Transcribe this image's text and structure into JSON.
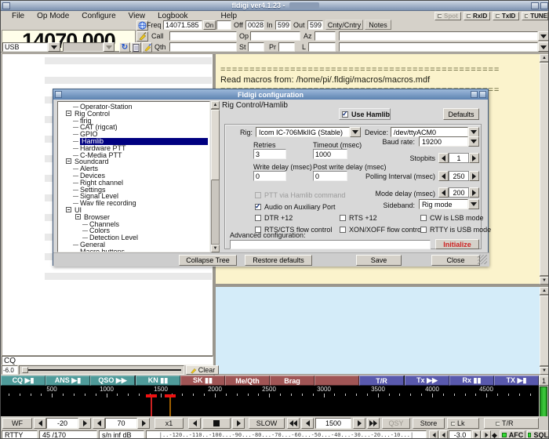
{
  "window": {
    "title": "fldigi ver4.1.23 -"
  },
  "menu": {
    "items": [
      "File",
      "Op Mode",
      "Configure",
      "View",
      "Logbook",
      "Help"
    ]
  },
  "id_buttons": [
    {
      "label": "Spot",
      "disabled": true
    },
    {
      "label": "RxID",
      "disabled": false
    },
    {
      "label": "TxID",
      "disabled": false
    },
    {
      "label": "TUNE",
      "disabled": false
    }
  ],
  "vfo": {
    "frequency": "14070.000",
    "mode": "USB"
  },
  "log_fields": {
    "freq_label": "Freq",
    "freq_value": "14071.585",
    "on_label": "On",
    "time_on_value": "",
    "off_label": "Off",
    "off_value": "0028",
    "in_label": "In",
    "in_value": "599",
    "out_label": "Out",
    "out_value": "599",
    "cnty_label": "Cnty/Cntry",
    "notes_label": "Notes",
    "call_label": "Call",
    "call_value": "",
    "op_label": "Op",
    "op_value": "",
    "az_label": "Az",
    "az_value": "",
    "qth_label": "Qth",
    "qth_value": "",
    "st_label": "St",
    "st_value": "",
    "pr_label": "Pr",
    "pr_value": "",
    "l_label": "L",
    "l_value": ""
  },
  "rx_pane": {
    "lines": [
      "================================================",
      "Read macros from: /home/pi/.fldigi/macros/macros.mdf",
      "================================================"
    ]
  },
  "browser": {
    "decoded_text": "CQ",
    "squelch_value": "-6.0",
    "clear_label": "Clear"
  },
  "macros": {
    "set_label": "1",
    "buttons": [
      {
        "label": "CQ ▶▮",
        "group": "teal"
      },
      {
        "label": "ANS ▶▮",
        "group": "teal"
      },
      {
        "label": "QSO ▶▶",
        "group": "teal"
      },
      {
        "label": "KN ▮▮",
        "group": "teal"
      },
      {
        "label": "SK ▮▮",
        "group": "red"
      },
      {
        "label": "Me/Qth",
        "group": "red"
      },
      {
        "label": "Brag",
        "group": "red"
      },
      {
        "label": "",
        "group": "red"
      },
      {
        "label": "T/R",
        "group": "blue"
      },
      {
        "label": "Tx ▶▶",
        "group": "blue"
      },
      {
        "label": "Rx ▮▮",
        "group": "blue"
      },
      {
        "label": "TX ▶▮",
        "group": "blue"
      }
    ]
  },
  "waterfall": {
    "scale_labels": [
      500,
      1000,
      1500,
      2000,
      2500,
      3000,
      3500,
      4000,
      4500
    ],
    "markers": [
      {
        "freq": 1415,
        "color": "#cc2222"
      },
      {
        "freq": 1585,
        "color": "#a06000"
      }
    ]
  },
  "wf_controls": {
    "wf_label": "WF",
    "lower_signal": "-20",
    "upper_signal": "70",
    "zoom_label": "x1",
    "speed_label": "SLOW",
    "center_freq": "1500",
    "qsy_label": "QSY",
    "store_label": "Store",
    "lock_label": "Lk",
    "tr_label": "T/R"
  },
  "status": {
    "mode": "RTTY",
    "shift": "45 /170",
    "snr": "s/n inf dB",
    "meter_scale": "|..-120..-110..-100...-90...-80...-70...-60...-50...-40...-30...-20...-10...|",
    "squelch_value": "-3.0",
    "afc_label": "AFC",
    "sql_label": "SQL"
  },
  "dialog": {
    "title": "Fldigi configuration",
    "tree": [
      {
        "label": "Operator-Station",
        "depth": 1
      },
      {
        "label": "Rig Control",
        "depth": 0,
        "box": true
      },
      {
        "label": "flrig",
        "depth": 1
      },
      {
        "label": "CAT (rigcat)",
        "depth": 1
      },
      {
        "label": "GPIO",
        "depth": 1
      },
      {
        "label": "Hamlib",
        "depth": 1,
        "selected": true
      },
      {
        "label": "Hardware PTT",
        "depth": 1
      },
      {
        "label": "C-Media PTT",
        "depth": 1
      },
      {
        "label": "Soundcard",
        "depth": 0,
        "box": true
      },
      {
        "label": "Alerts",
        "depth": 1
      },
      {
        "label": "Devices",
        "depth": 1
      },
      {
        "label": "Right channel",
        "depth": 1
      },
      {
        "label": "Settings",
        "depth": 1
      },
      {
        "label": "Signal Level",
        "depth": 1
      },
      {
        "label": "Wav file recording",
        "depth": 1
      },
      {
        "label": "UI",
        "depth": 0,
        "box": true
      },
      {
        "label": "Browser",
        "depth": 1,
        "box": true
      },
      {
        "label": "Channels",
        "depth": 2
      },
      {
        "label": "Colors",
        "depth": 2
      },
      {
        "label": "Detection Level",
        "depth": 2
      },
      {
        "label": "General",
        "depth": 1
      },
      {
        "label": "Macro buttons",
        "depth": 1
      }
    ],
    "panel": {
      "header": "Rig Control/Hamlib",
      "use_hamlib": {
        "label": "Use Hamlib",
        "checked": true
      },
      "defaults_button": "Defaults",
      "rig": {
        "label": "Rig:",
        "value": "Icom IC-706MkIIG  (Stable)"
      },
      "device": {
        "label": "Device:",
        "value": "/dev/ttyACM0"
      },
      "retries": {
        "label": "Retries",
        "value": "3"
      },
      "timeout": {
        "label": "Timeout (msec)",
        "value": "1000"
      },
      "baud": {
        "label": "Baud rate:",
        "value": "19200"
      },
      "stopbits": {
        "label": "Stopbits",
        "value": "1"
      },
      "write_delay": {
        "label": "Write delay (msec)",
        "value": "0"
      },
      "post_write_delay": {
        "label": "Post write delay (msec)",
        "value": "0"
      },
      "polling": {
        "label": "Polling Interval (msec)",
        "value": "250"
      },
      "ptt_hamlib": {
        "label": "PTT via Hamlib command",
        "checked": false,
        "disabled": true
      },
      "audio_aux": {
        "label": "Audio on Auxiliary Port",
        "checked": true
      },
      "mode_delay": {
        "label": "Mode delay (msec)",
        "value": "200"
      },
      "sideband": {
        "label": "Sideband:",
        "value": "Rig mode"
      },
      "options": [
        {
          "label": "DTR +12",
          "checked": false
        },
        {
          "label": "RTS +12",
          "checked": false
        },
        {
          "label": "CW is LSB mode",
          "checked": false
        },
        {
          "label": "RTS/CTS flow control",
          "checked": false
        },
        {
          "label": "XON/XOFF flow control",
          "checked": false
        },
        {
          "label": "RTTY is USB mode",
          "checked": false
        }
      ],
      "advanced": {
        "label": "Advanced configuration:",
        "value": ""
      },
      "initialize_button": "Initialize"
    },
    "footer_buttons": [
      "Collapse Tree",
      "Restore defaults",
      "Save",
      "Close"
    ]
  }
}
